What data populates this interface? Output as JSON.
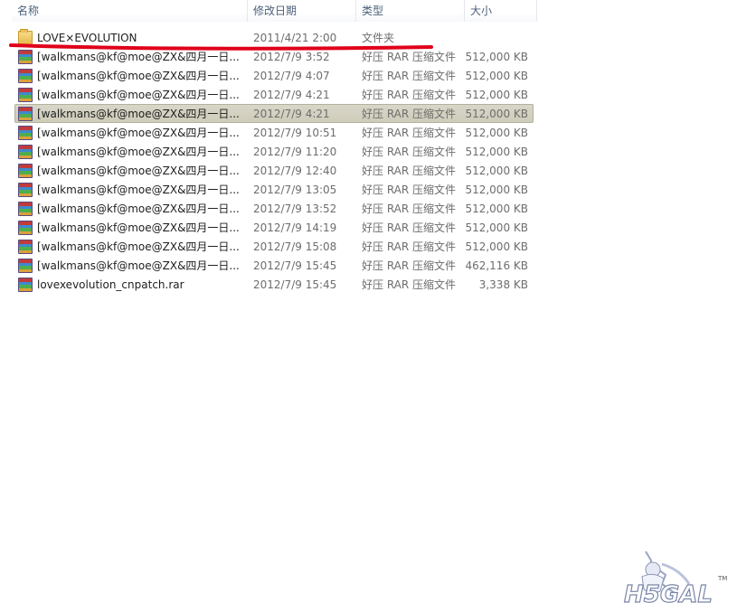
{
  "columns": {
    "name": "名称",
    "date": "修改日期",
    "type": "类型",
    "size": "大小"
  },
  "files": [
    {
      "icon": "folder-icon",
      "name": "LOVE×EVOLUTION",
      "date": "2011/4/21 2:00",
      "type": "文件夹",
      "size": ""
    },
    {
      "icon": "rar-archive-icon",
      "name": "[walkmans@kf@moe@ZX&四月一日...",
      "date": "2012/7/9 3:52",
      "type": "好压 RAR 压缩文件",
      "size": "512,000 KB"
    },
    {
      "icon": "rar-archive-icon",
      "name": "[walkmans@kf@moe@ZX&四月一日...",
      "date": "2012/7/9 4:07",
      "type": "好压 RAR 压缩文件",
      "size": "512,000 KB"
    },
    {
      "icon": "rar-archive-icon",
      "name": "[walkmans@kf@moe@ZX&四月一日...",
      "date": "2012/7/9 4:21",
      "type": "好压 RAR 压缩文件",
      "size": "512,000 KB"
    },
    {
      "icon": "rar-archive-icon",
      "name": "[walkmans@kf@moe@ZX&四月一日...",
      "date": "2012/7/9 4:21",
      "type": "好压 RAR 压缩文件",
      "size": "512,000 KB",
      "selected": true
    },
    {
      "icon": "rar-archive-icon",
      "name": "[walkmans@kf@moe@ZX&四月一日...",
      "date": "2012/7/9 10:51",
      "type": "好压 RAR 压缩文件",
      "size": "512,000 KB"
    },
    {
      "icon": "rar-archive-icon",
      "name": "[walkmans@kf@moe@ZX&四月一日...",
      "date": "2012/7/9 11:20",
      "type": "好压 RAR 压缩文件",
      "size": "512,000 KB"
    },
    {
      "icon": "rar-archive-icon",
      "name": "[walkmans@kf@moe@ZX&四月一日...",
      "date": "2012/7/9 12:40",
      "type": "好压 RAR 压缩文件",
      "size": "512,000 KB"
    },
    {
      "icon": "rar-archive-icon",
      "name": "[walkmans@kf@moe@ZX&四月一日...",
      "date": "2012/7/9 13:05",
      "type": "好压 RAR 压缩文件",
      "size": "512,000 KB"
    },
    {
      "icon": "rar-archive-icon",
      "name": "[walkmans@kf@moe@ZX&四月一日...",
      "date": "2012/7/9 13:52",
      "type": "好压 RAR 压缩文件",
      "size": "512,000 KB"
    },
    {
      "icon": "rar-archive-icon",
      "name": "[walkmans@kf@moe@ZX&四月一日...",
      "date": "2012/7/9 14:19",
      "type": "好压 RAR 压缩文件",
      "size": "512,000 KB"
    },
    {
      "icon": "rar-archive-icon",
      "name": "[walkmans@kf@moe@ZX&四月一日...",
      "date": "2012/7/9 15:08",
      "type": "好压 RAR 压缩文件",
      "size": "512,000 KB"
    },
    {
      "icon": "rar-archive-icon",
      "name": "[walkmans@kf@moe@ZX&四月一日...",
      "date": "2012/7/9 15:45",
      "type": "好压 RAR 压缩文件",
      "size": "462,116 KB"
    },
    {
      "icon": "rar-archive-icon",
      "name": "lovexevolution_cnpatch.rar",
      "date": "2012/7/9 15:45",
      "type": "好压 RAR 压缩文件",
      "size": "3,338 KB"
    }
  ],
  "colors": {
    "selection": "#d4d2c2",
    "annotation": "#e0001a",
    "header_text": "#4c607a"
  },
  "watermark": {
    "logo_text": "H5GAL",
    "tm": "TM"
  }
}
